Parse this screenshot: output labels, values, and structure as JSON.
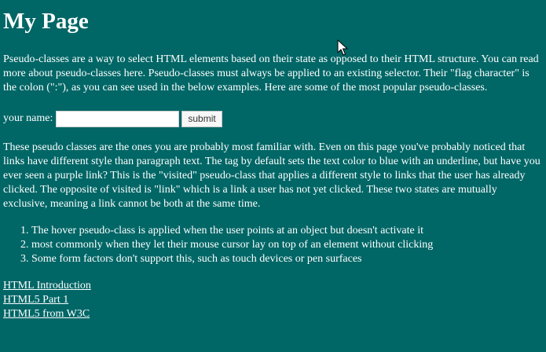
{
  "page": {
    "title": "My Page",
    "intro": "Pseudo-classes are a way to select HTML elements based on their state as opposed to their HTML structure. You can read more about pseudo-classes here. Pseudo-classes must always be applied to an existing selector. Their \"flag character\" is the colon (\":\"), as you can see used in the below examples. Here are some of the most popular pseudo-classes.",
    "form": {
      "label": "your name:",
      "input_value": "",
      "submit_label": "submit"
    },
    "second_paragraph": "These pseudo classes are the ones you are probably most familiar with. Even on this page you've probably noticed that links have different style than paragraph text. The tag by default sets the text color to blue with an underline, but have you ever seen a purple link? This is the \"visited\" pseudo-class that applies a different style to links that the user has already clicked. The opposite of visited is \"link\" which is a link a user has not yet clicked. These two states are mutually exclusive, meaning a link cannot be both at the same time.",
    "list": [
      "The hover pseudo-class is applied when the user points at an object but doesn't activate it",
      "most commonly when they let their mouse cursor lay on top of an element without clicking",
      "Some form factors don't support this, such as touch devices or pen surfaces"
    ],
    "links": [
      "HTML Introduction",
      "HTML5 Part 1",
      "HTML5 from W3C"
    ]
  },
  "colors": {
    "background": "#006666",
    "text": "#ffffff"
  },
  "icons": {
    "cursor": "mouse-pointer-icon"
  }
}
